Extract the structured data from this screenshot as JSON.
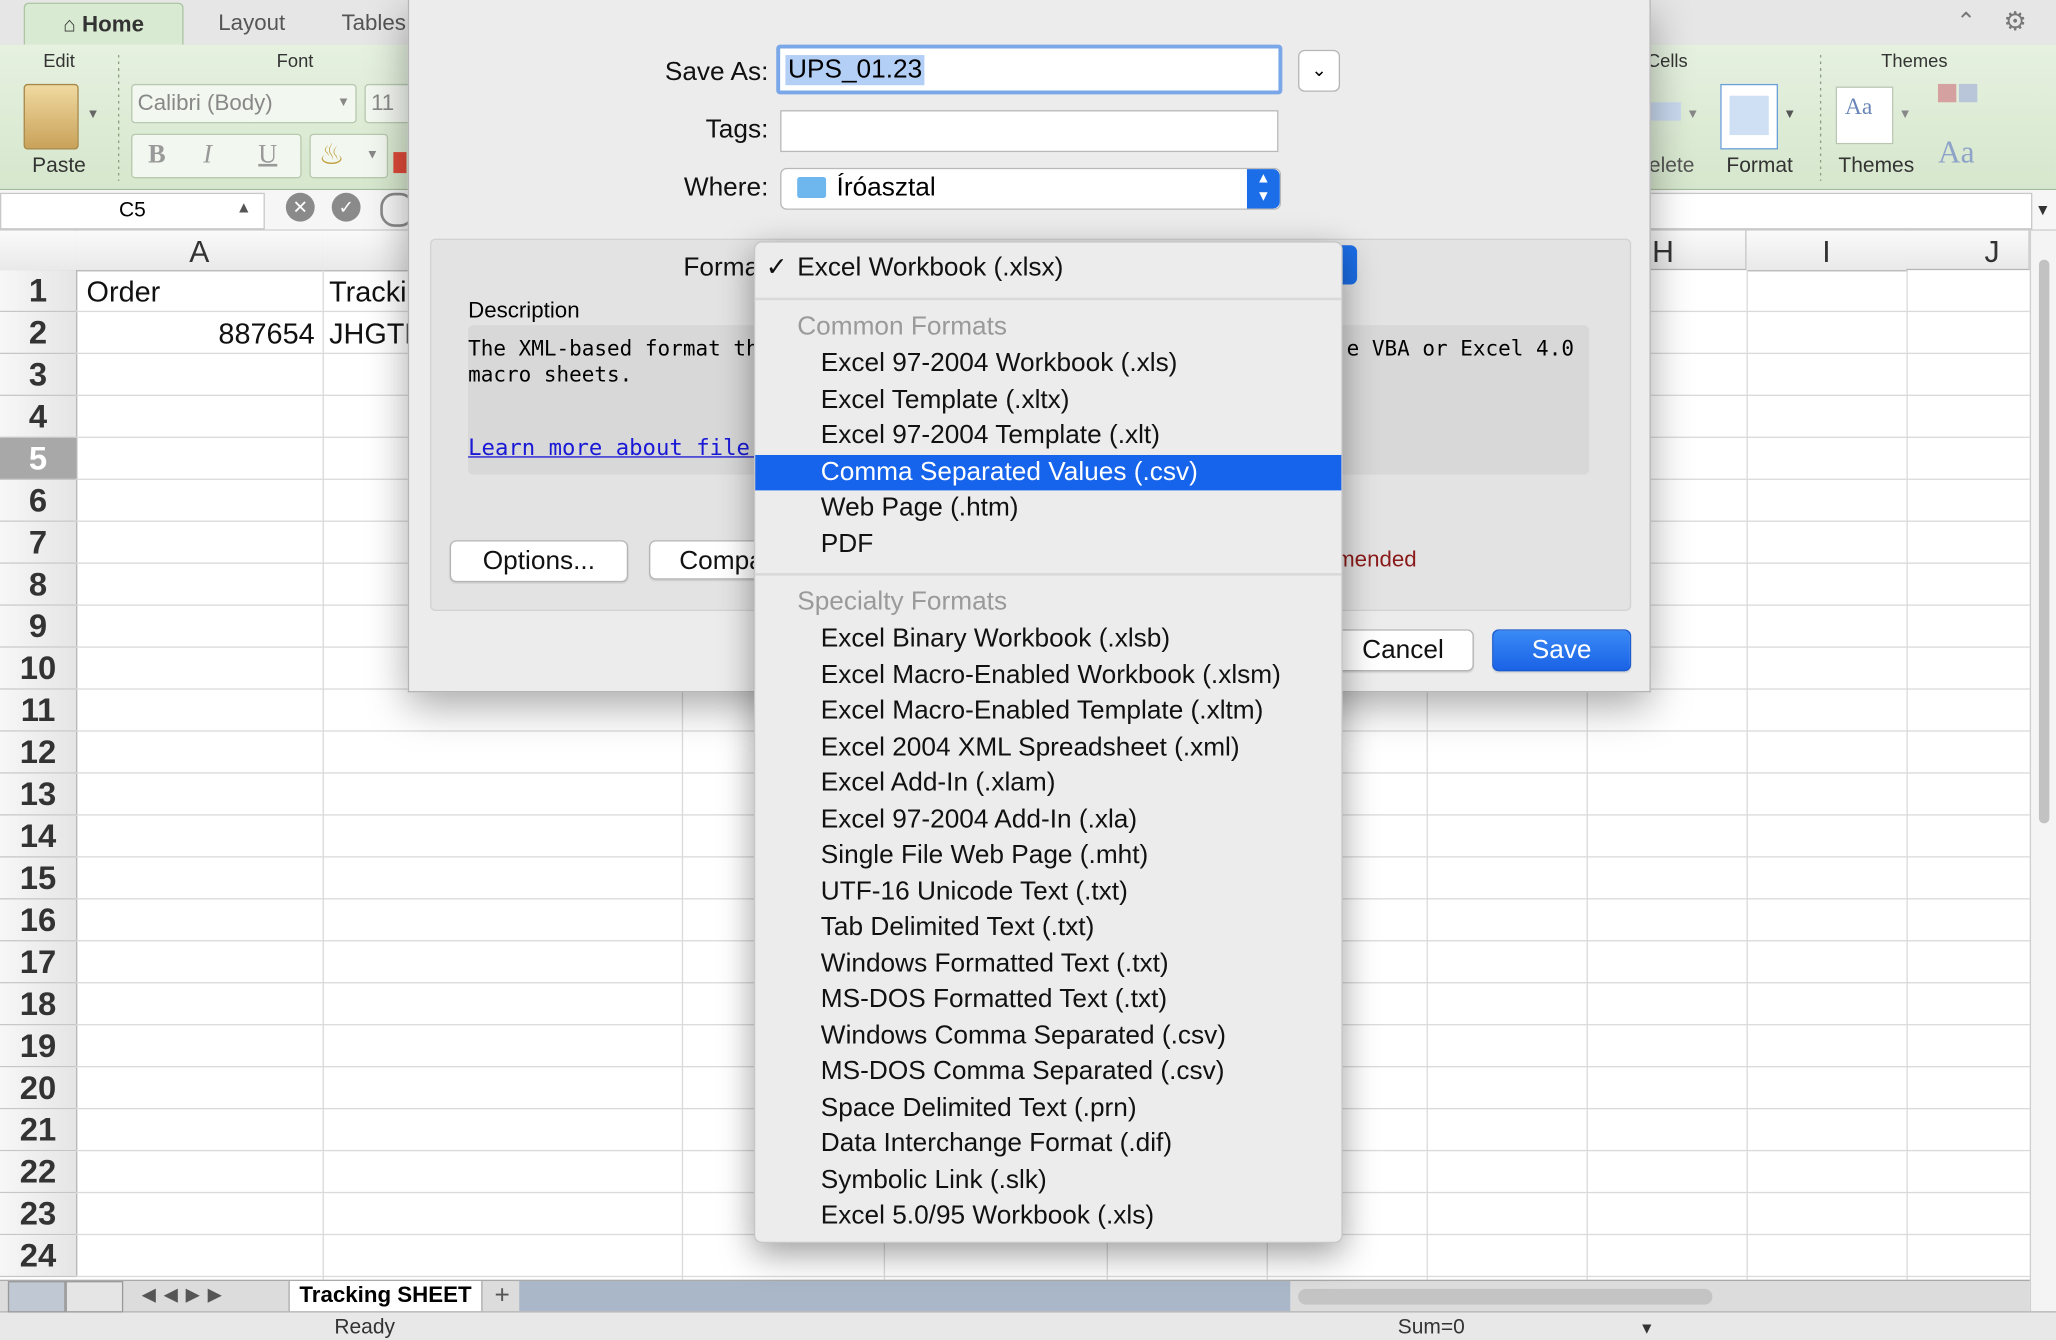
{
  "ribbon": {
    "tabs": [
      "Home",
      "Layout",
      "Tables"
    ],
    "groups": {
      "edit": "Edit",
      "font": "Font",
      "cells": "Cells",
      "themes": "Themes"
    },
    "paste_label": "Paste",
    "font_name": "Calibri (Body)",
    "font_size": "11",
    "delete_label": "Delete",
    "format_label": "Format",
    "themes_label": "Themes",
    "bold": "B",
    "italic": "I",
    "underline": "U",
    "aa": "Aa"
  },
  "formula_bar": {
    "name_box": "C5"
  },
  "grid": {
    "columns": [
      "A",
      "H",
      "I",
      "J"
    ],
    "rows": [
      "1",
      "2",
      "3",
      "4",
      "5",
      "6",
      "7",
      "8",
      "9",
      "10",
      "11",
      "12",
      "13",
      "14",
      "15",
      "16",
      "17",
      "18",
      "19",
      "20",
      "21",
      "22",
      "23",
      "24"
    ],
    "selected_row": "5",
    "a1": "Order",
    "b1": "Tracki",
    "a2": "887654",
    "b2": "JHGTF"
  },
  "sheet_tab": "Tracking SHEET",
  "add_sheet": "+",
  "status": {
    "ready": "Ready",
    "sum": "Sum=0"
  },
  "dialog": {
    "save_as_label": "Save As:",
    "filename": "UPS_01.23",
    "tags_label": "Tags:",
    "where_label": "Where:",
    "where_value": "Íróasztal",
    "format_label": "Forma",
    "description_label": "Description",
    "description_left_1": "The XML-based format tha",
    "description_left_2": "macro sheets.",
    "description_right": "e VBA or Excel 4.0",
    "learn_more": "Learn more about file form",
    "options_button": "Options...",
    "compat_button": "Compa",
    "recommended_text": "mended",
    "cancel_button": "Cancel",
    "save_button": "Save"
  },
  "format_menu": {
    "checked_item": "Excel Workbook (.xlsx)",
    "common_header": "Common Formats",
    "common_items": [
      "Excel 97-2004 Workbook (.xls)",
      "Excel Template (.xltx)",
      "Excel 97-2004 Template (.xlt)",
      "Comma Separated Values (.csv)",
      "Web Page (.htm)",
      "PDF"
    ],
    "selected_item": "Comma Separated Values (.csv)",
    "specialty_header": "Specialty Formats",
    "specialty_items": [
      "Excel Binary Workbook (.xlsb)",
      "Excel Macro-Enabled Workbook (.xlsm)",
      "Excel Macro-Enabled Template (.xltm)",
      "Excel 2004 XML Spreadsheet (.xml)",
      "Excel Add-In (.xlam)",
      "Excel 97-2004 Add-In (.xla)",
      "Single File Web Page (.mht)",
      "UTF-16 Unicode Text (.txt)",
      "Tab Delimited Text (.txt)",
      "Windows Formatted Text (.txt)",
      "MS-DOS Formatted Text (.txt)",
      "Windows Comma Separated (.csv)",
      "MS-DOS Comma Separated (.csv)",
      "Space Delimited Text (.prn)",
      "Data Interchange Format (.dif)",
      "Symbolic Link (.slk)",
      "Excel 5.0/95 Workbook (.xls)"
    ]
  },
  "colors": {
    "accent": "#1764ec",
    "ribbon": "#d8ead1",
    "link": "#1a1ad6",
    "warning": "#8b1a1a"
  }
}
